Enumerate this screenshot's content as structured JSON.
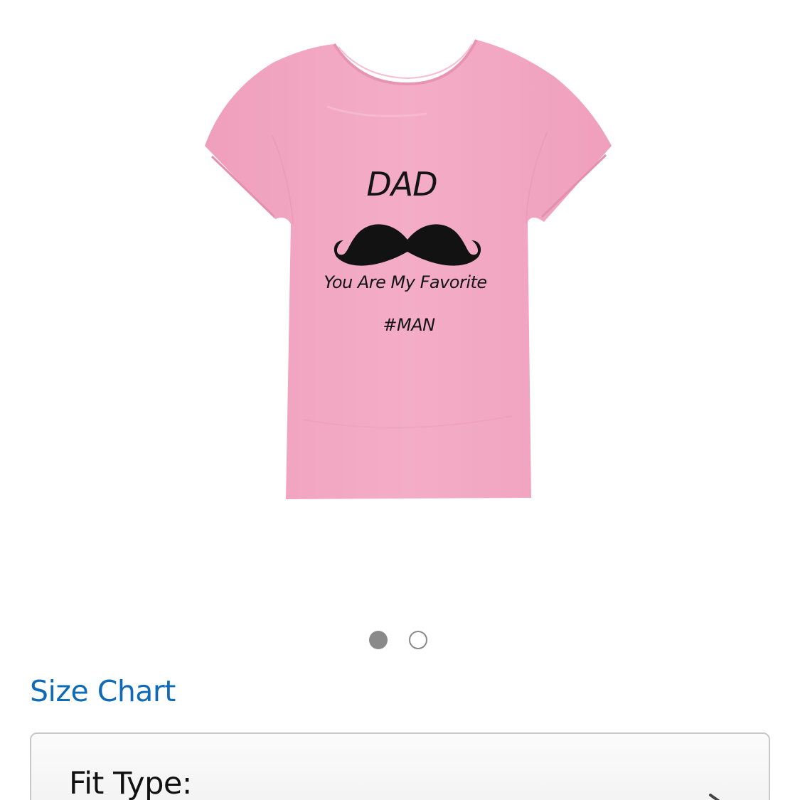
{
  "product": {
    "print_title": "DAD",
    "print_line": "You Are My Favorite",
    "print_tag": "#MAN",
    "shirt_color": "#f3a8c4",
    "print_color": "#141414",
    "image_icon": "moustache-icon"
  },
  "carousel": {
    "active_index": 0,
    "count": 2
  },
  "links": {
    "size_chart": "Size Chart",
    "link_color": "#0f6bb7"
  },
  "selector": {
    "label": "Fit Type:",
    "icon": "chevron-right-icon"
  }
}
